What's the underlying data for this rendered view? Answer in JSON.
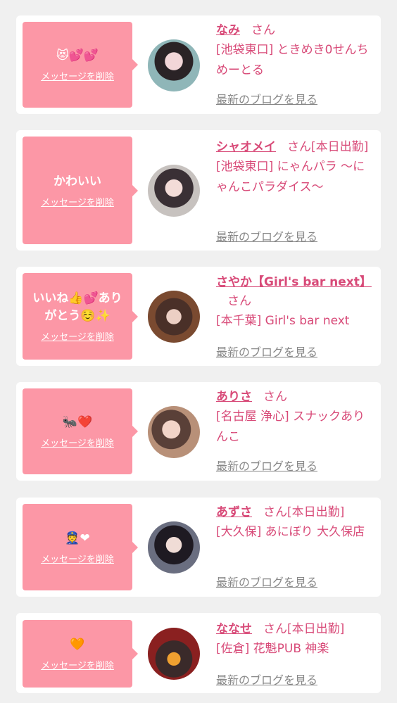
{
  "messages": [
    {
      "message": "😻💕💕",
      "delete_label": "メッセージを削除",
      "name": "なみ",
      "honorific": "さん",
      "status": "",
      "shop": "[池袋東口] ときめき0せんちめーとる",
      "blog_label": "最新のブログを見る"
    },
    {
      "message": "かわいい",
      "delete_label": "メッセージを削除",
      "name": "シャオメイ",
      "honorific": "さん",
      "status": "[本日出勤]",
      "shop": "[池袋東口] にゃんパラ 〜にゃんこパラダイス〜",
      "blog_label": "最新のブログを見る"
    },
    {
      "message": "いいね👍💕ありがとう☺️✨",
      "delete_label": "メッセージを削除",
      "name": "さやか【Girl's bar next】",
      "honorific": "さん",
      "status": "",
      "shop": "[本千葉] Girl's bar next",
      "blog_label": "最新のブログを見る"
    },
    {
      "message": "🐜❤️",
      "delete_label": "メッセージを削除",
      "name": "ありさ",
      "honorific": "さん",
      "status": "",
      "shop": "[名古屋 浄心] スナックありんこ",
      "blog_label": "最新のブログを見る"
    },
    {
      "message": "👮❤",
      "delete_label": "メッセージを削除",
      "name": "あずさ",
      "honorific": "さん",
      "status": "[本日出勤]",
      "shop": "[大久保] あにぼり 大久保店",
      "blog_label": "最新のブログを見る"
    },
    {
      "message": "🧡",
      "delete_label": "メッセージを削除",
      "name": "ななせ",
      "honorific": "さん",
      "status": "[本日出勤]",
      "shop": "[佐倉] 花魁PUB 神楽",
      "blog_label": "最新のブログを見る"
    }
  ],
  "colors": {
    "background": "#f0f0f0",
    "card": "#ffffff",
    "bubble": "#fc97a6",
    "name": "#d84a78",
    "link_gray": "#888888"
  }
}
